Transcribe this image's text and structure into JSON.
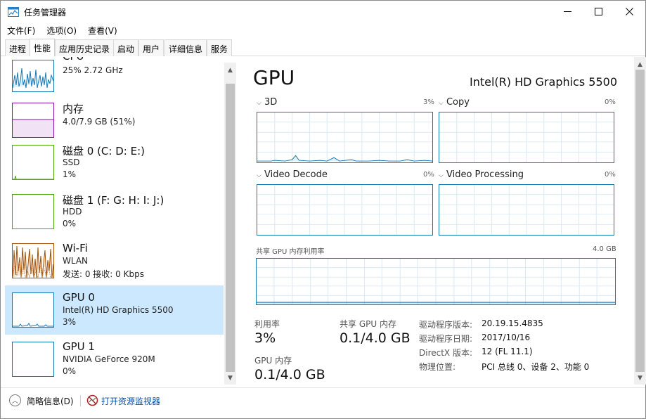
{
  "window": {
    "title": "任务管理器"
  },
  "menu": [
    "文件(F)",
    "选项(O)",
    "查看(V)"
  ],
  "tabs": [
    "进程",
    "性能",
    "应用历史记录",
    "启动",
    "用户",
    "详细信息",
    "服务"
  ],
  "active_tab": "性能",
  "resources": [
    {
      "title": "CPU",
      "sub1": "25% 2.72 GHz",
      "sub2": "",
      "color": "#1378b5",
      "selected": false
    },
    {
      "title": "内存",
      "sub1": "4.0/7.9 GB (51%)",
      "sub2": "",
      "color": "#8b12ae",
      "selected": false
    },
    {
      "title": "磁盘 0 (C: D: E:)",
      "sub1": "SSD",
      "sub2": "1%",
      "color": "#4da60c",
      "selected": false
    },
    {
      "title": "磁盘 1 (F: G: H: I: J:)",
      "sub1": "HDD",
      "sub2": "0%",
      "color": "#4da60c",
      "selected": false
    },
    {
      "title": "Wi-Fi",
      "sub1": "WLAN",
      "sub2": "发送: 0 接收: 0 Kbps",
      "color": "#a74f01",
      "selected": false
    },
    {
      "title": "GPU 0",
      "sub1": "Intel(R) HD Graphics 5500",
      "sub2": "3%",
      "color": "#1378b5",
      "selected": true
    },
    {
      "title": "GPU 1",
      "sub1": "NVIDIA GeForce 920M",
      "sub2": "0%",
      "color": "#1378b5",
      "selected": false
    }
  ],
  "detail": {
    "heading": "GPU",
    "model": "Intel(R) HD Graphics 5500",
    "engines": [
      {
        "name": "3D",
        "pct": "3%"
      },
      {
        "name": "Copy",
        "pct": "0%"
      },
      {
        "name": "Video Decode",
        "pct": "0%"
      },
      {
        "name": "Video Processing",
        "pct": "0%"
      }
    ],
    "shared_memory": {
      "label": "共享 GPU 内存利用率",
      "max": "4.0 GB"
    },
    "stats": {
      "util_label": "利用率",
      "util_value": "3%",
      "shared_label": "共享 GPU 内存",
      "shared_value": "0.1/4.0 GB",
      "gpu_mem_label": "GPU 内存",
      "gpu_mem_value": "0.1/4.0 GB"
    },
    "info": [
      {
        "label": "驱动程序版本:",
        "value": "20.19.15.4835"
      },
      {
        "label": "驱动程序日期:",
        "value": "2017/10/16"
      },
      {
        "label": "DirectX 版本:",
        "value": "12 (FL 11.1)"
      },
      {
        "label": "物理位置:",
        "value": "PCI 总线 0、设备 2、功能 0"
      }
    ]
  },
  "footer": {
    "fewer_details": "简略信息(D)",
    "resource_monitor": "打开资源监视器"
  },
  "colors": {
    "accent": "#1378b5",
    "selected_bg": "#cce8ff",
    "link": "#0a4fa6"
  }
}
